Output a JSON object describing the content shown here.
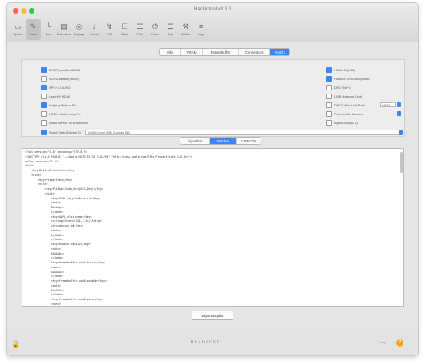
{
  "window": {
    "title": "Hackintool v3.8.0"
  },
  "toolbar": {
    "items": [
      {
        "label": "System",
        "icon": "monitor-icon",
        "glyph": "▭"
      },
      {
        "label": "Patch",
        "icon": "brush-icon",
        "glyph": "✎"
      },
      {
        "label": "Boot",
        "icon": "boot-icon",
        "glyph": "└"
      },
      {
        "label": "Extensions",
        "icon": "extensions-icon",
        "glyph": "▤"
      },
      {
        "label": "Displays",
        "icon": "display-icon",
        "glyph": "◎"
      },
      {
        "label": "Sound",
        "icon": "sound-icon",
        "glyph": "♪"
      },
      {
        "label": "USB",
        "icon": "usb-icon",
        "glyph": "↯"
      },
      {
        "label": "Disks",
        "icon": "disk-icon",
        "glyph": "☐"
      },
      {
        "label": "PCIe",
        "icon": "pcie-icon",
        "glyph": "☷"
      },
      {
        "label": "Power",
        "icon": "power-icon",
        "glyph": "⏻"
      },
      {
        "label": "Calc",
        "icon": "calculator-icon",
        "glyph": "☰"
      },
      {
        "label": "Utilities",
        "icon": "wrench-icon",
        "glyph": "⚒"
      },
      {
        "label": "Logs",
        "icon": "log-icon",
        "glyph": "≡"
      }
    ]
  },
  "tabs": [
    {
      "label": "Info"
    },
    {
      "label": "VRAM"
    },
    {
      "label": "Framebuffer"
    },
    {
      "label": "Connectors"
    },
    {
      "label": "Patch"
    }
  ],
  "options": {
    "left": [
      {
        "label": "DVMT-prealloc 32 MB",
        "checked": true
      },
      {
        "label": "VGPU stealth(mode)",
        "checked": false
      },
      {
        "label": "SPI >= 14UHD",
        "checked": true
      },
      {
        "label": "Use HW HDMI",
        "checked": false
      },
      {
        "label": "Hotplug Reboot Fix",
        "checked": true
      },
      {
        "label": "HDMI Infinite Loop Fix",
        "checked": false
      },
      {
        "label": "Audio Device ID w/Injection",
        "checked": false
      }
    ],
    "right": [
      {
        "label": "HDMI 20(K4B)",
        "checked": true
      },
      {
        "label": "HDMI20 UHD w/Injection",
        "checked": true
      },
      {
        "label": "DP2 Tls Fix",
        "checked": false
      },
      {
        "label": "USB Hotswap Limit",
        "checked": false
      },
      {
        "label": "DPCD Max Link Rate",
        "checked": false,
        "value": "HBR3"
      },
      {
        "label": "FramebufferMemory",
        "checked": false
      },
      {
        "label": "Agdc Data (ID1)",
        "checked": false
      }
    ],
    "spoof": {
      "label": "Spoof Video Device ID",
      "checked": true,
      "value": "0x3E92: Intel UHD Graphics 630"
    }
  },
  "mode_segments": [
    {
      "label": "Algorithm"
    },
    {
      "label": "Patches"
    },
    {
      "label": "LSPCON"
    }
  ],
  "editor": {
    "lines": [
      "<?xml version=\"1.0\" encoding=\"UTF-8\"?>",
      "<!DOCTYPE plist PUBLIC \"-//Apple//DTD PLIST 1.0//EN\" \"http://www.apple.com/DTDs/PropertyList-1.0.dtd\">",
      "<plist version=\"1.0\">",
      "<dict>",
      "    <key>DeviceProperties</key>",
      "    <dict>",
      "        <key>Properties</key>",
      "        <dict>",
      "            <key>PciRoot(0x0)/Pci(0x2,0x0)</key>",
      "            <dict>",
      "                <key>AAPL,ig-platform-id</key>",
      "                <data>",
      "                BwCbPg==",
      "                </data>",
      "                <key>AAPL,slot-name</key>",
      "                <string>Internal@0,2,0</string>",
      "                <key>device-id</key>",
      "                <data>",
      "                kj4AAA==",
      "                </data>",
      "                <key>enable-hdmi20</key>",
      "                <data>",
      "                AQAAAA==",
      "                </data>",
      "                <key>framebuffer-con0-busid</key>",
      "                <data>",
      "                AAAAAA==",
      "                </data>",
      "                <key>framebuffer-con0-enable</key>",
      "                <data>",
      "                AQAAAA==",
      "                </data>",
      "                <key>framebuffer-con0-pipe</key>",
      "                <data>"
    ]
  },
  "buttons": {
    "generate": "Export as plist"
  },
  "footer": {
    "logo": "HEADSOFT",
    "help": "Help"
  }
}
